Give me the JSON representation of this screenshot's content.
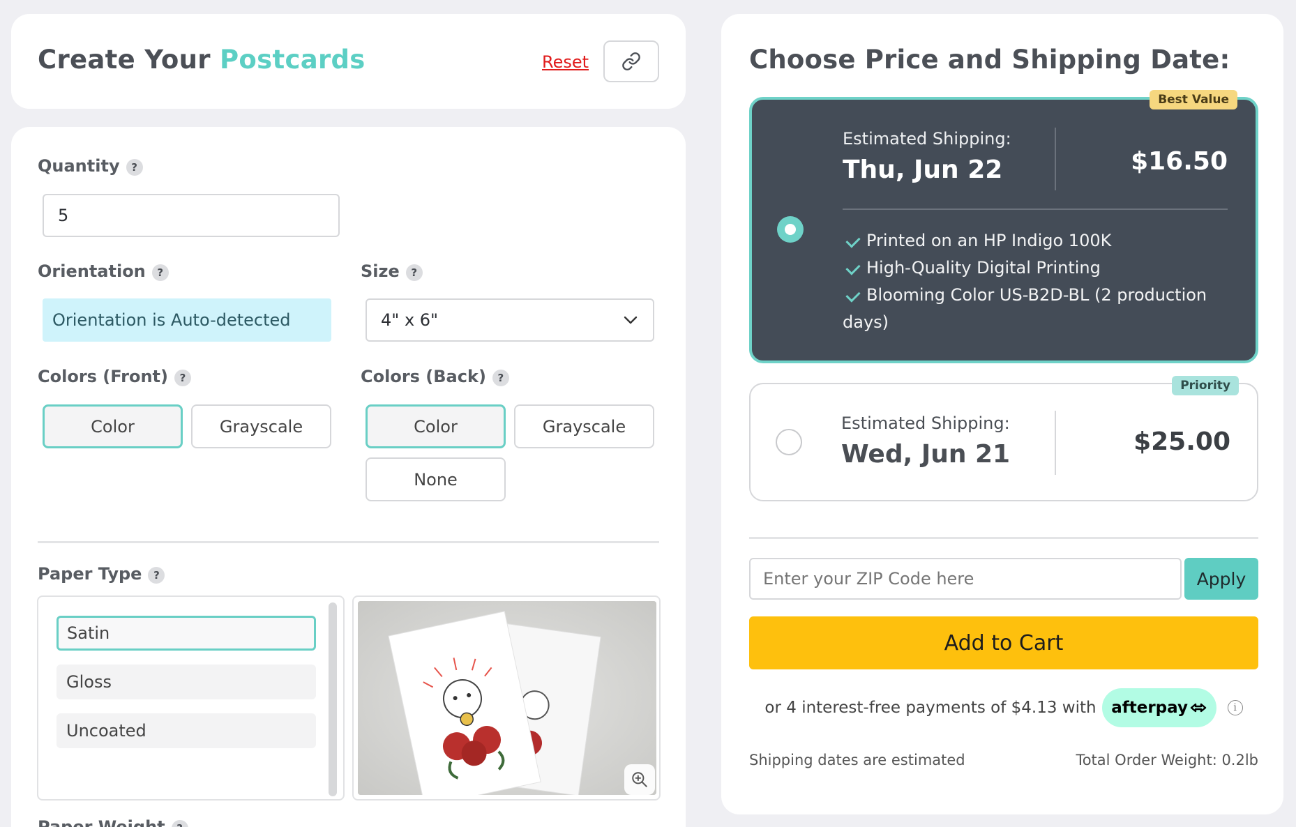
{
  "header": {
    "title_prefix": "Create Your ",
    "title_accent": "Postcards",
    "reset_label": "Reset",
    "link_icon": "link-icon"
  },
  "options": {
    "quantity": {
      "label": "Quantity",
      "help": "?",
      "value": "5"
    },
    "orientation": {
      "label": "Orientation",
      "help": "?",
      "info": "Orientation is Auto-detected"
    },
    "size": {
      "label": "Size",
      "help": "?",
      "selected": "4\" x 6\""
    },
    "colors_front": {
      "label": "Colors (Front)",
      "help": "?",
      "options": [
        "Color",
        "Grayscale"
      ],
      "selected": "Color"
    },
    "colors_back": {
      "label": "Colors (Back)",
      "help": "?",
      "options": [
        "Color",
        "Grayscale",
        "None"
      ],
      "selected": "Color"
    },
    "paper_type": {
      "label": "Paper Type",
      "help": "?",
      "options": [
        "Satin",
        "Gloss",
        "Uncoated"
      ],
      "selected": "Satin"
    },
    "paper_weight": {
      "label": "Paper Weight"
    }
  },
  "shipping": {
    "title": "Choose Price and Shipping Date:",
    "options": [
      {
        "badge": "Best Value",
        "est_label": "Estimated Shipping:",
        "date": "Thu, Jun 22",
        "price": "$16.50",
        "selected": true,
        "features": [
          "Printed on an HP Indigo 100K",
          "High-Quality Digital Printing",
          "Blooming Color US-B2D-BL (2 production"
        ],
        "features_wrap": "days)"
      },
      {
        "badge": "Priority",
        "est_label": "Estimated Shipping:",
        "date": "Wed, Jun 21",
        "price": "$25.00",
        "selected": false
      }
    ],
    "zip_placeholder": "Enter your ZIP Code here",
    "apply_label": "Apply",
    "cart_label": "Add to Cart",
    "afterpay_text": "or 4 interest-free payments of $4.13 with",
    "afterpay_brand": "afterpay",
    "info_glyph": "i",
    "footer_left": "Shipping dates are estimated",
    "footer_right": "Total Order Weight: 0.2lb"
  },
  "colors": {
    "accent": "#5ccfc4",
    "dark_card": "#444c57",
    "cart_yellow": "#fec00d",
    "reset_red": "#e01b1b",
    "badge_best": "#f6d77f",
    "badge_priority": "#a9e3dd"
  }
}
